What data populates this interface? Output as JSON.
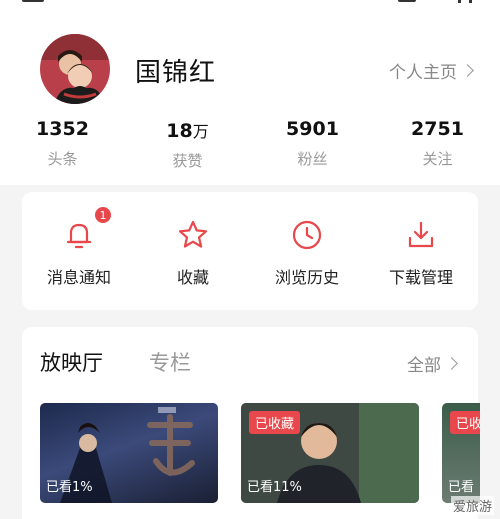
{
  "profile": {
    "name": "国锦红",
    "homepage_label": "个人主页"
  },
  "stats": [
    {
      "value": "1352",
      "unit": "",
      "label": "头条"
    },
    {
      "value": "18",
      "unit": "万",
      "label": "获赞"
    },
    {
      "value": "5901",
      "unit": "",
      "label": "粉丝"
    },
    {
      "value": "2751",
      "unit": "",
      "label": "关注"
    }
  ],
  "shortcuts": {
    "notifications": {
      "label": "消息通知",
      "badge": "1",
      "icon": "bell-icon"
    },
    "favorites": {
      "label": "收藏",
      "icon": "star-icon"
    },
    "history": {
      "label": "浏览历史",
      "icon": "clock-icon"
    },
    "downloads": {
      "label": "下载管理",
      "icon": "download-icon"
    }
  },
  "theater": {
    "tab_active": "放映厅",
    "tab_other": "专栏",
    "all_label": "全部",
    "cards": [
      {
        "watched": "已看1%",
        "collected": ""
      },
      {
        "watched": "已看11%",
        "collected": "已收藏"
      },
      {
        "watched": "已看",
        "collected": "已收"
      }
    ]
  },
  "watermark": "爱旅游",
  "colors": {
    "accent": "#e8474b",
    "muted": "#999999"
  }
}
